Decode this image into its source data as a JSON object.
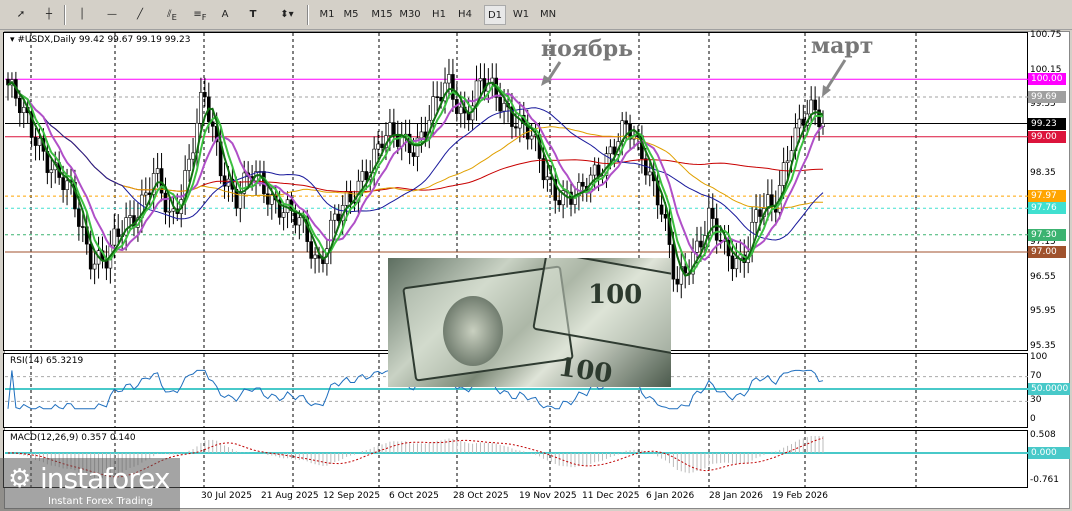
{
  "toolbar": {
    "tools": [
      "cursor-icon",
      "crosshair-icon",
      "vertical-line-icon",
      "horizontal-line-icon",
      "trendline-icon",
      "fibonacci-icon",
      "fibo-levels-icon",
      "text-icon",
      "text-label-icon",
      "arrows-icon"
    ],
    "labels": {
      "fib_e": "E",
      "fib_f": "F",
      "text": "A",
      "label": "T"
    },
    "timeframes": [
      "M1",
      "M5",
      "M15",
      "M30",
      "H1",
      "H4",
      "D1",
      "W1",
      "MN"
    ],
    "active_timeframe": "D1"
  },
  "chart": {
    "symbol_info": "#USDX,Daily  99.42 99.67 99.19 99.23",
    "price_ticks": [
      "100.75",
      "100.15",
      "99.55",
      "98.95",
      "98.35",
      "97.75",
      "97.15",
      "96.55",
      "95.95",
      "95.35"
    ],
    "price_max": 100.75,
    "price_min": 95.35,
    "levels": [
      {
        "label": "100.00",
        "price": 100.0,
        "color": "#ff00ff",
        "style": "solid"
      },
      {
        "label": "99.69",
        "price": 99.69,
        "color": "#a0a0a0",
        "style": "dashed"
      },
      {
        "label": "99.23",
        "price": 99.23,
        "color": "#000000",
        "style": "solid"
      },
      {
        "label": "99.00",
        "price": 99.0,
        "color": "#dc143c",
        "style": "solid"
      },
      {
        "label": "97.97",
        "price": 97.97,
        "color": "#ffa500",
        "style": "dashed"
      },
      {
        "label": "97.76",
        "price": 97.76,
        "color": "#40e0d0",
        "style": "dashed"
      },
      {
        "label": "97.30",
        "price": 97.3,
        "color": "#3cb371",
        "style": "dashed"
      },
      {
        "label": "97.00",
        "price": 97.0,
        "color": "#a0522d",
        "style": "solid"
      }
    ],
    "closes": [
      99.9,
      99.3,
      98.9,
      98.3,
      97.9,
      97.0,
      96.8,
      97.4,
      97.8,
      98.3,
      97.5,
      98.5,
      99.7,
      98.5,
      98.0,
      98.3,
      98.0,
      97.8,
      97.4,
      96.8,
      97.6,
      97.8,
      98.5,
      99.0,
      98.9,
      98.9,
      99.4,
      99.9,
      99.4,
      99.9,
      99.7,
      99.4,
      99.0,
      98.3,
      98.0,
      97.9,
      98.4,
      98.8,
      99.1,
      98.7,
      97.9,
      96.3,
      97.0,
      97.6,
      96.9,
      96.9,
      97.7,
      97.7,
      99.0,
      99.4,
      99.23
    ],
    "annotations": [
      {
        "text": "ноябрь"
      },
      {
        "text": "март"
      }
    ]
  },
  "rsi": {
    "label": "RSI(14) 65.3219",
    "ticks": [
      "100",
      "70",
      "50.0000",
      "30",
      "0"
    ]
  },
  "macd": {
    "label": "MACD(12,26,9) 0.357 0.140",
    "ticks": [
      "0.508",
      "0.000",
      "-0.761"
    ]
  },
  "dates": [
    "30 Jul 2025",
    "21 Aug 2025",
    "12 Sep 2025",
    "6 Oct 2025",
    "28 Oct 2025",
    "19 Nov 2025",
    "11 Dec 2025",
    "6 Jan 2026",
    "28 Jan 2026",
    "19 Feb 2026"
  ],
  "logo": {
    "brand": "instaforex",
    "tagline": "Instant Forex Trading"
  },
  "photo": {
    "denomination": "100"
  }
}
